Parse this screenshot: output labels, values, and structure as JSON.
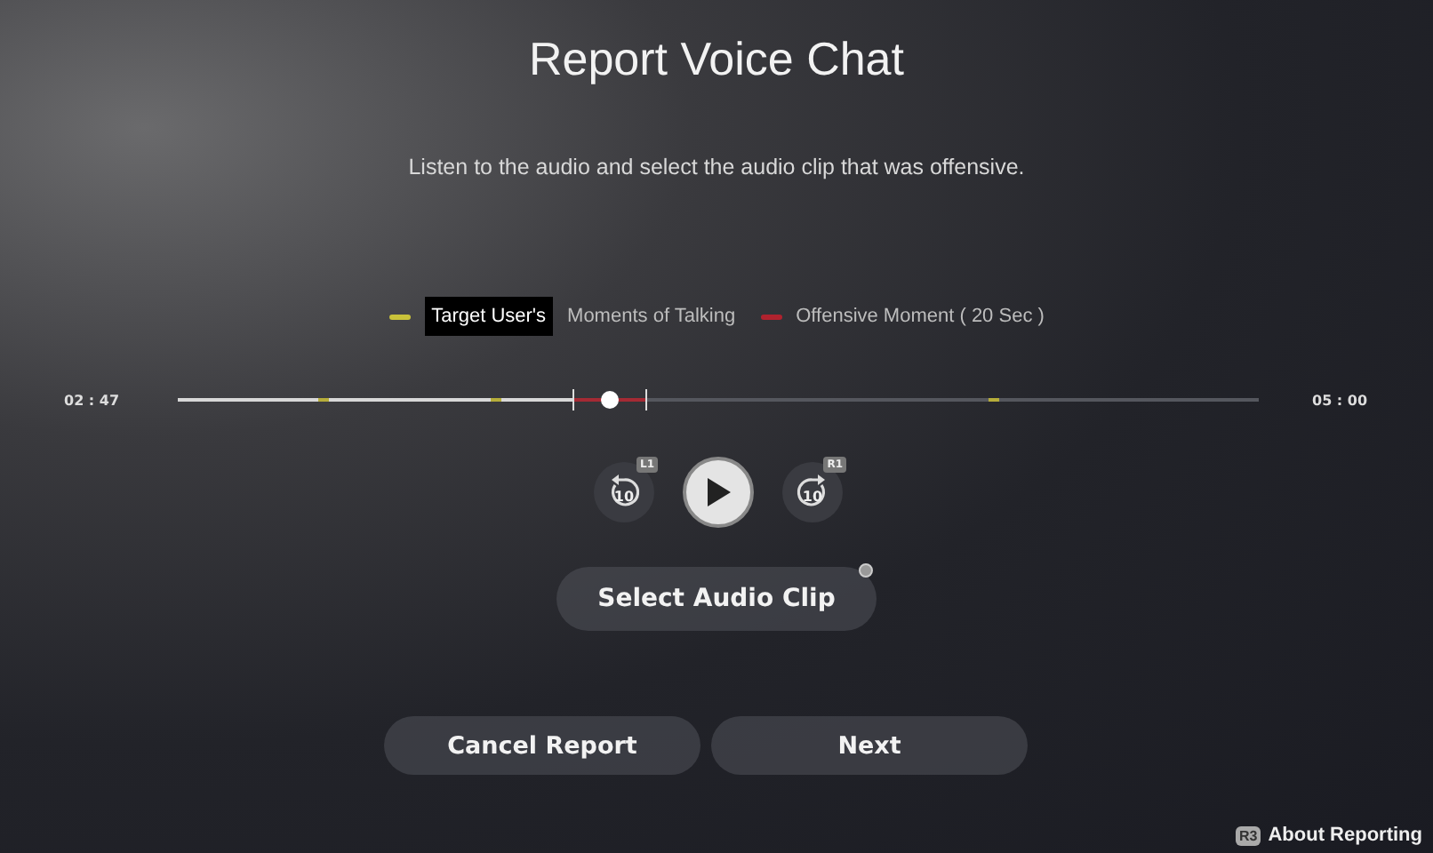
{
  "title": "Report Voice Chat",
  "instruction": "Listen to the audio and select the audio clip that was offensive.",
  "legend": [
    {
      "kind": "talking",
      "highlight": "Target User's",
      "label": "Moments of Talking"
    },
    {
      "kind": "offensive",
      "label": "Offensive Moment ( 20 Sec )"
    }
  ],
  "timeline": {
    "current": "02 : 47",
    "total": "05 : 00",
    "level": 0.4
  },
  "playback": {
    "rewind_badge": "L1",
    "forward_badge": "R1",
    "rewind_seconds": "10",
    "forward_seconds": "10"
  },
  "select_button": "Select Audio Clip",
  "buttons": [
    "Cancel Report",
    "Next"
  ],
  "footer": {
    "badge": "R3",
    "label": "About Reporting"
  }
}
